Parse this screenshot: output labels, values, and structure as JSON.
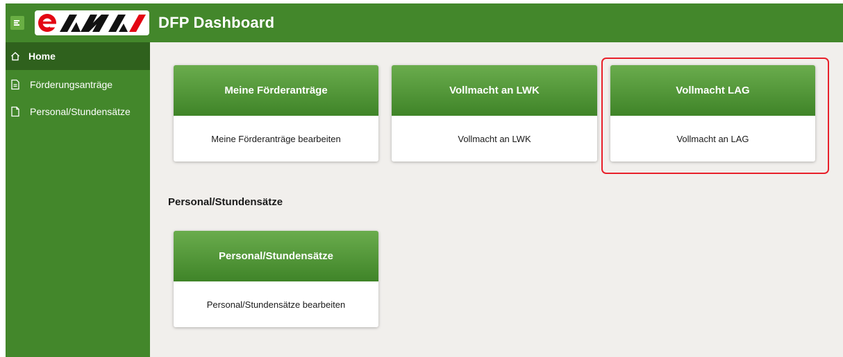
{
  "header": {
    "app_title": "DFP Dashboard",
    "logo_text": "eAMA",
    "brand_color": "#43872b"
  },
  "sidebar": {
    "items": [
      {
        "label": "Home",
        "icon": "home-icon",
        "active": true
      },
      {
        "label": "Förderungsanträge",
        "icon": "document-icon",
        "active": false
      },
      {
        "label": "Personal/Stundensätze",
        "icon": "file-icon",
        "active": false
      }
    ]
  },
  "main": {
    "cards": [
      {
        "title": "Meine Förderanträge",
        "description": "Meine Förderanträge bearbeiten"
      },
      {
        "title": "Vollmacht an LWK",
        "description": "Vollmacht an LWK"
      },
      {
        "title": "Vollmacht LAG",
        "description": "Vollmacht an LAG",
        "highlighted": true
      }
    ],
    "section_title": "Personal/Stundensätze",
    "section_cards": [
      {
        "title": "Personal/Stundensätze",
        "description": "Personal/Stundensätze bearbeiten"
      }
    ]
  },
  "colors": {
    "highlight": "#e8202a",
    "logo_red": "#e30613",
    "sidebar_active": "#2f611d"
  }
}
